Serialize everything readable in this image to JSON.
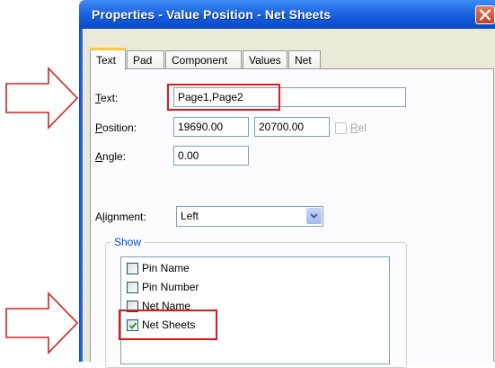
{
  "window": {
    "title": "Properties - Value Position - Net Sheets"
  },
  "tabs": [
    {
      "label": "Text",
      "active": true
    },
    {
      "label": "Pad",
      "active": false
    },
    {
      "label": "Component",
      "active": false
    },
    {
      "label": "Values",
      "active": false
    },
    {
      "label": "Net",
      "active": false
    }
  ],
  "form": {
    "text_label": "Text:",
    "text_value": "Page1,Page2",
    "position_label": "Position:",
    "position_x": "19690.00",
    "position_y": "20700.00",
    "rel_label": "Rel",
    "rel_checked": false,
    "angle_label": "Angle:",
    "angle_value": "0.00",
    "alignment_label": "Alignment:",
    "alignment_value": "Left"
  },
  "show": {
    "title": "Show",
    "items": [
      {
        "label": "Pin Name",
        "checked": false
      },
      {
        "label": "Pin Number",
        "checked": false
      },
      {
        "label": "Net Name",
        "checked": false
      },
      {
        "label": "Net Sheets",
        "checked": true
      }
    ]
  },
  "colors": {
    "highlight": "#e01818",
    "titlebar": "#0a4fd0",
    "dialog_bg": "#ece9d8"
  },
  "icons": [
    "close-icon",
    "chevron-down-icon",
    "checkmark-icon",
    "arrow-right-icon"
  ]
}
